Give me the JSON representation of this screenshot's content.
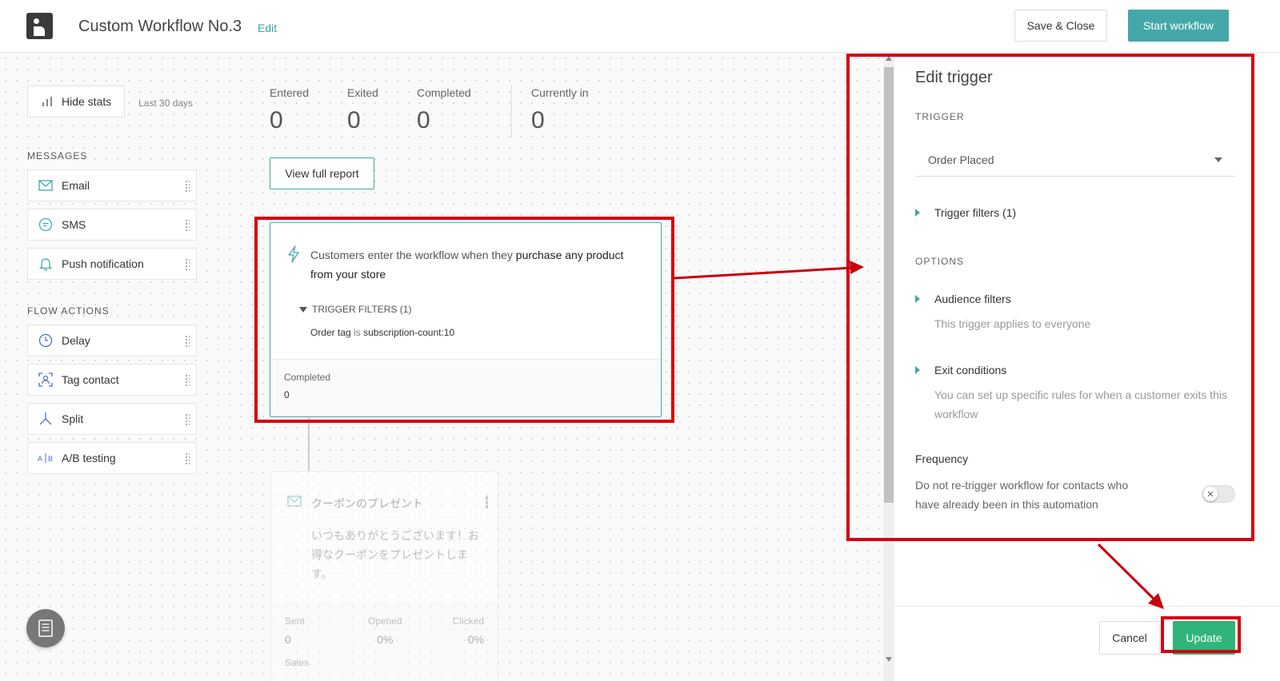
{
  "header": {
    "title": "Custom Workflow No.3",
    "edit_label": "Edit",
    "save_close_label": "Save & Close",
    "start_label": "Start workflow"
  },
  "sidebar": {
    "hide_stats_label": "Hide stats",
    "range_label": "Last 30 days",
    "messages_heading": "MESSAGES",
    "messages": [
      {
        "label": "Email",
        "icon": "envelope-icon"
      },
      {
        "label": "SMS",
        "icon": "chat-bubble-icon"
      },
      {
        "label": "Push notification",
        "icon": "bell-icon"
      }
    ],
    "flow_heading": "FLOW ACTIONS",
    "flow_actions": [
      {
        "label": "Delay",
        "icon": "clock-icon"
      },
      {
        "label": "Tag contact",
        "icon": "tag-contact-icon"
      },
      {
        "label": "Split",
        "icon": "split-icon"
      },
      {
        "label": "A/B testing",
        "icon": "ab-icon"
      }
    ]
  },
  "stats": [
    {
      "label": "Entered",
      "value": "0"
    },
    {
      "label": "Exited",
      "value": "0"
    },
    {
      "label": "Completed",
      "value": "0"
    },
    {
      "label": "Currently in",
      "value": "0"
    }
  ],
  "report_label": "View full report",
  "trigger_card": {
    "desc_prefix": "Customers enter the workflow when they ",
    "desc_highlight": "purchase any product from your store",
    "filters_heading": "TRIGGER FILTERS (1)",
    "filter_field": "Order tag",
    "filter_op": "is",
    "filter_value": "subscription-count:10",
    "footer_label": "Completed",
    "footer_value": "0"
  },
  "email_card": {
    "title": "クーポンのプレゼント",
    "body": "いつもありがとうございます！お得なクーポンをプレゼントします。",
    "stats": [
      {
        "label": "Sent",
        "value": "0"
      },
      {
        "label": "Opened",
        "value": "0%"
      },
      {
        "label": "Clicked",
        "value": "0%"
      }
    ],
    "sales_label": "Sales"
  },
  "panel": {
    "title": "Edit trigger",
    "trigger_heading": "TRIGGER",
    "trigger_value": "Order Placed",
    "trigger_filters_label": "Trigger filters (1)",
    "options_heading": "OPTIONS",
    "audience_label": "Audience filters",
    "audience_sub": "This trigger applies to everyone",
    "exit_label": "Exit conditions",
    "exit_sub": "You can set up specific rules for when a customer exits this workflow",
    "frequency_title": "Frequency",
    "frequency_text": "Do not re-trigger workflow for contacts who have already been in this automation",
    "toggle_on": false,
    "cancel_label": "Cancel",
    "update_label": "Update"
  },
  "colors": {
    "accent": "#45a8a8",
    "update": "#2fb57a",
    "annotation": "#d7000f"
  }
}
